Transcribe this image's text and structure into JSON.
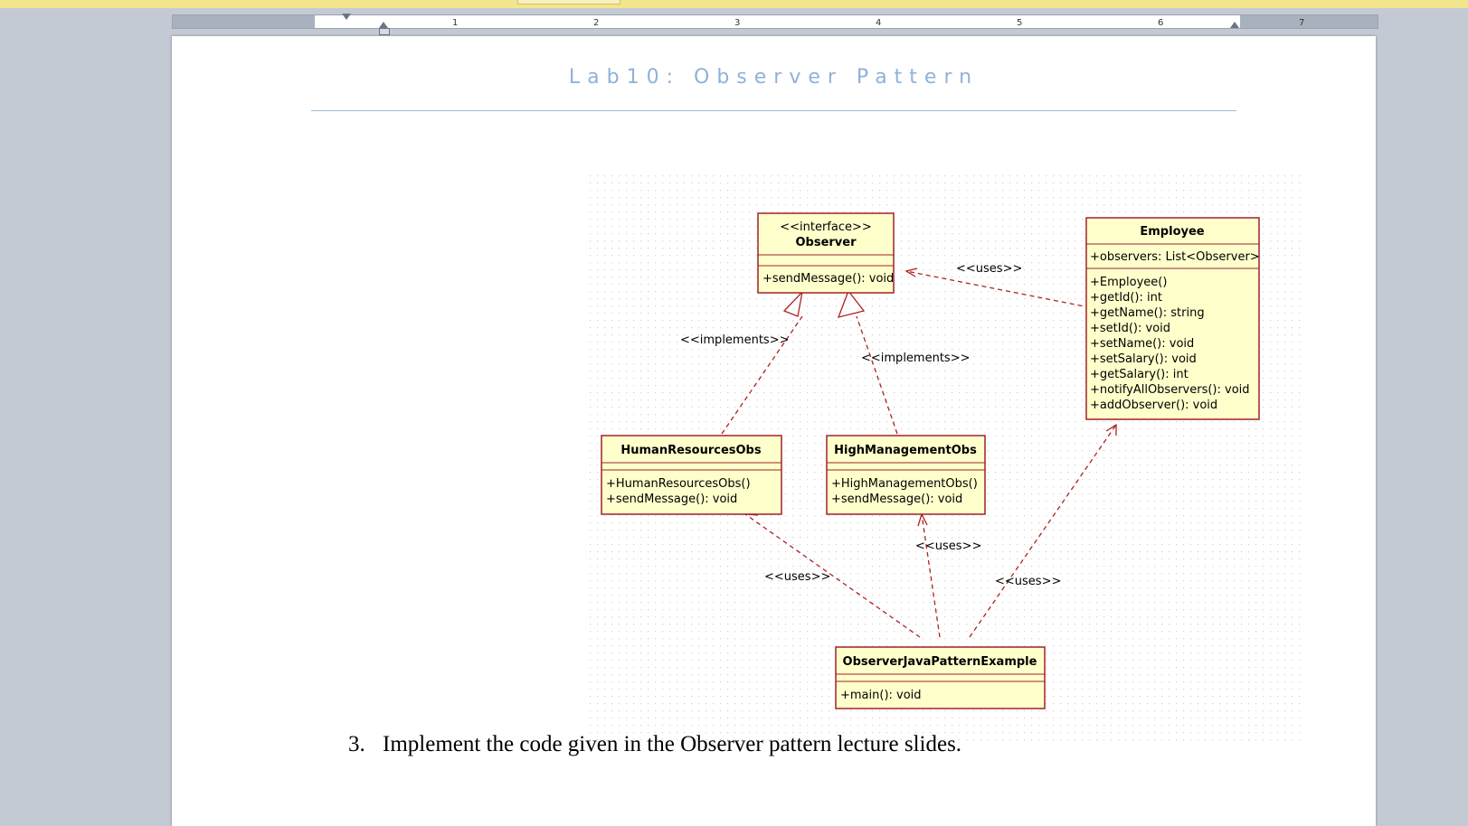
{
  "ruler": {
    "marks": [
      "1",
      "2",
      "3",
      "4",
      "5",
      "6",
      "7"
    ]
  },
  "document": {
    "title": "Lab10: Observer Pattern",
    "list_number": "3.",
    "list_text": "Implement the code given in the Observer pattern lecture slides."
  },
  "diagram": {
    "classes": {
      "observer": {
        "stereotype": "<<interface>>",
        "name": "Observer",
        "attributes": [],
        "methods": [
          "+sendMessage(): void"
        ]
      },
      "employee": {
        "name": "Employee",
        "attributes": [
          "+observers: List<Observer>"
        ],
        "methods": [
          "+Employee()",
          "+getId(): int",
          "+getName(): string",
          "+setId(): void",
          "+setName(): void",
          "+setSalary(): void",
          "+getSalary(): int",
          "+notifyAllObservers(): void",
          "+addObserver(): void"
        ]
      },
      "hr": {
        "name": "HumanResourcesObs",
        "attributes": [],
        "methods": [
          "+HumanResourcesObs()",
          "+sendMessage(): void"
        ]
      },
      "hm": {
        "name": "HighManagementObs",
        "attributes": [],
        "methods": [
          "+HighManagementObs()",
          "+sendMessage(): void"
        ]
      },
      "example": {
        "name": "ObserverJavaPatternExample",
        "attributes": [],
        "methods": [
          "+main(): void"
        ]
      }
    },
    "labels": {
      "emp_obs": "<<uses>>",
      "hr_impl": "<<implements>>",
      "hm_impl": "<<implements>>",
      "ex_hm": "<<uses>>",
      "ex_hr": "<<uses>>",
      "ex_emp": "<<uses>>"
    },
    "colors": {
      "box_fill": "#ffffcc",
      "box_stroke": "#a0202a",
      "line": "#b02020",
      "grid_dot": "#d3d3d3"
    }
  }
}
